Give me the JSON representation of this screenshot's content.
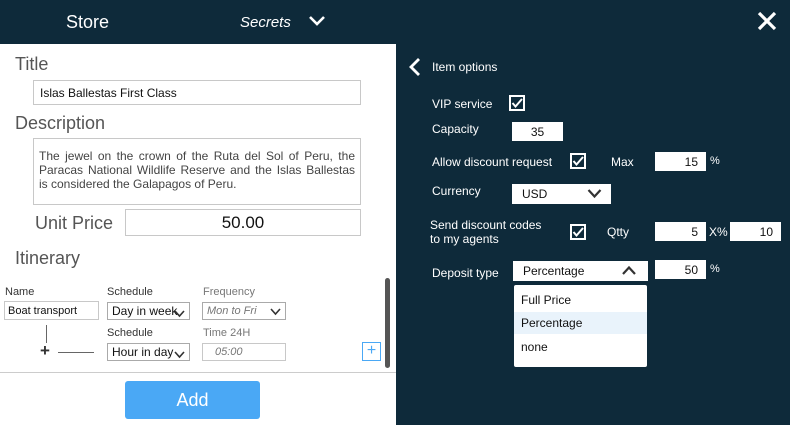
{
  "header": {
    "title": "Store",
    "menu_label": "Secrets"
  },
  "form": {
    "title_label": "Title",
    "title_value": "Islas Ballestas First Class",
    "description_label": "Description",
    "description_value": "The jewel on the crown of the Ruta del Sol of Peru, the Paracas National Wildlife Reserve and the Islas Ballestas is considered the Galapagos of Peru.",
    "unit_price_label": "Unit Price",
    "unit_price_value": "50.00",
    "itinerary_label": "Itinerary",
    "add_button": "Add"
  },
  "itinerary": {
    "name_label": "Name",
    "name_value": "Boat transport",
    "schedule_label": "Schedule",
    "schedule_value": "Day in week",
    "frequency_label": "Frequency",
    "frequency_value": "Mon to Fri",
    "schedule2_label": "Schedule",
    "schedule2_value": "Hour in day",
    "time_label": "Time 24H",
    "time_value": "05:00"
  },
  "options": {
    "title": "Item options",
    "vip_label": "VIP service",
    "vip_checked": true,
    "capacity_label": "Capacity",
    "capacity_value": "35",
    "discount_label": "Allow discount request",
    "discount_checked": true,
    "max_label": "Max",
    "max_value": "15",
    "percent_symbol": "%",
    "currency_label": "Currency",
    "currency_value": "USD",
    "codes_label_line1": "Send discount codes",
    "codes_label_line2": "to my agents",
    "codes_checked": true,
    "qtty_label": "Qtty",
    "qtty_value": "5",
    "x_percent_label": "X%",
    "x_percent_value": "10",
    "deposit_label": "Deposit type",
    "deposit_value": "Percentage",
    "deposit_percent": "50",
    "deposit_options": [
      "Full Price",
      "Percentage",
      "none"
    ]
  },
  "colors": {
    "dark_bg": "#0e2a3a",
    "accent": "#4aa8f5"
  }
}
